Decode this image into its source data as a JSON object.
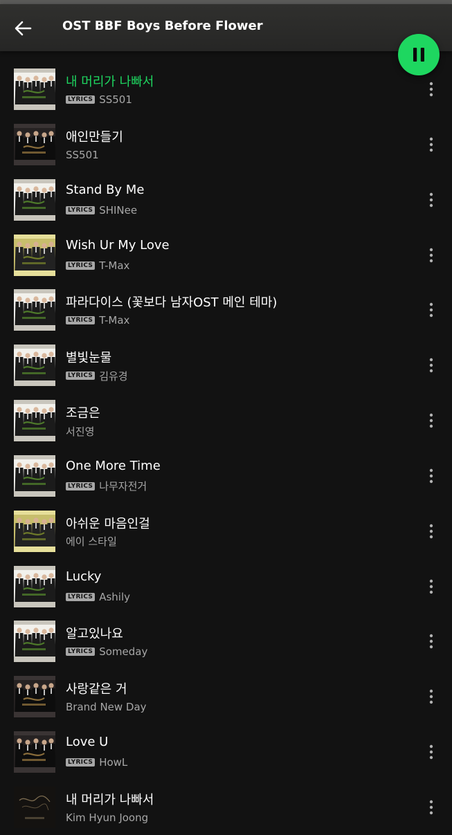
{
  "header": {
    "title": "OST BBF Boys Before Flower",
    "back_icon": "arrow-left-icon",
    "play_state_icon": "pause-icon"
  },
  "colors": {
    "accent": "#1ed760",
    "background": "#121212",
    "header": "#2b2b2a",
    "secondary_text": "#a7a7a7",
    "badge": "#a7a7a7"
  },
  "lyrics_badge_label": "LYRICS",
  "tracks": [
    {
      "title": "내 머리가 나빠서",
      "artist": "SS501",
      "lyrics": true,
      "playing": true,
      "art": "group-white"
    },
    {
      "title": "애인만들기",
      "artist": "SS501",
      "lyrics": false,
      "playing": false,
      "art": "group-dark"
    },
    {
      "title": "Stand By Me",
      "artist": "SHINee",
      "lyrics": true,
      "playing": false,
      "art": "group-white"
    },
    {
      "title": "Wish Ur My Love",
      "artist": "T-Max",
      "lyrics": true,
      "playing": false,
      "art": "group-olive"
    },
    {
      "title": "파라다이스 (꽃보다 남자OST 메인 테마)",
      "artist": "T-Max",
      "lyrics": true,
      "playing": false,
      "art": "group-white"
    },
    {
      "title": "별빛눈물",
      "artist": "김유경",
      "lyrics": true,
      "playing": false,
      "art": "group-white"
    },
    {
      "title": "조금은",
      "artist": "서진영",
      "lyrics": false,
      "playing": false,
      "art": "group-white"
    },
    {
      "title": "One More Time",
      "artist": "나무자전거",
      "lyrics": true,
      "playing": false,
      "art": "group-white"
    },
    {
      "title": "아쉬운 마음인걸",
      "artist": "에이 스타일",
      "lyrics": false,
      "playing": false,
      "art": "group-olive"
    },
    {
      "title": "Lucky",
      "artist": "Ashily",
      "lyrics": true,
      "playing": false,
      "art": "group-white"
    },
    {
      "title": "알고있나요",
      "artist": "Someday",
      "lyrics": true,
      "playing": false,
      "art": "group-white"
    },
    {
      "title": "사랑같은 거",
      "artist": "Brand New Day",
      "lyrics": false,
      "playing": false,
      "art": "group-dark"
    },
    {
      "title": "Love U",
      "artist": "HowL",
      "lyrics": true,
      "playing": false,
      "art": "group-dark"
    },
    {
      "title": "내 머리가 나빠서",
      "artist": "Kim Hyun Joong",
      "lyrics": false,
      "playing": false,
      "art": "dark-script"
    }
  ]
}
